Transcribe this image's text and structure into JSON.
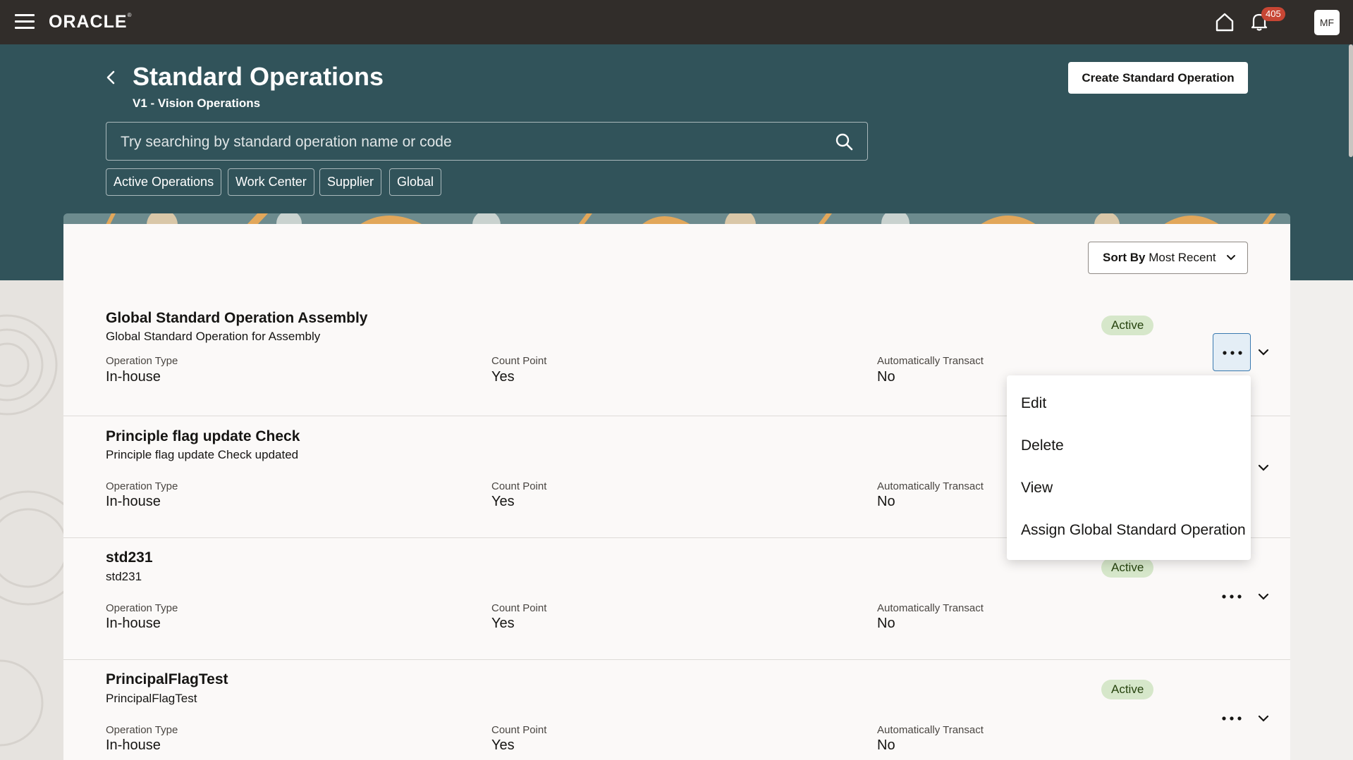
{
  "topbar": {
    "brand": "ORACLE",
    "brand_mark": "®",
    "notifications_count": "405",
    "user_initials": "MF"
  },
  "header": {
    "title": "Standard Operations",
    "subtitle": "V1 - Vision Operations",
    "create_button": "Create Standard Operation",
    "search_placeholder": "Try searching by standard operation name or code",
    "filters": [
      "Active Operations",
      "Work Center",
      "Supplier",
      "Global"
    ]
  },
  "sort": {
    "label": "Sort By",
    "value": "Most Recent"
  },
  "field_labels": {
    "operation_type": "Operation Type",
    "count_point": "Count Point",
    "auto_transact": "Automatically Transact"
  },
  "rows": [
    {
      "title": "Global Standard Operation Assembly",
      "description": "Global Standard Operation for Assembly",
      "operation_type": "In-house",
      "count_point": "Yes",
      "auto_transact": "No",
      "status": "Active"
    },
    {
      "title": "Principle flag update Check",
      "description": "Principle flag update Check updated",
      "operation_type": "In-house",
      "count_point": "Yes",
      "auto_transact": "No",
      "status": ""
    },
    {
      "title": "std231",
      "description": "std231",
      "operation_type": "In-house",
      "count_point": "Yes",
      "auto_transact": "No",
      "status": "Active"
    },
    {
      "title": "PrincipalFlagTest",
      "description": "PrincipalFlagTest",
      "operation_type": "In-house",
      "count_point": "Yes",
      "auto_transact": "No",
      "status": "Active"
    }
  ],
  "menu": {
    "items": [
      "Edit",
      "Delete",
      "View",
      "Assign Global Standard Operation"
    ]
  },
  "colors": {
    "topbar": "#312d2a",
    "header_band": "#31535a",
    "badge_active_bg": "#d6e7ca",
    "notification_badge": "#c74634"
  }
}
